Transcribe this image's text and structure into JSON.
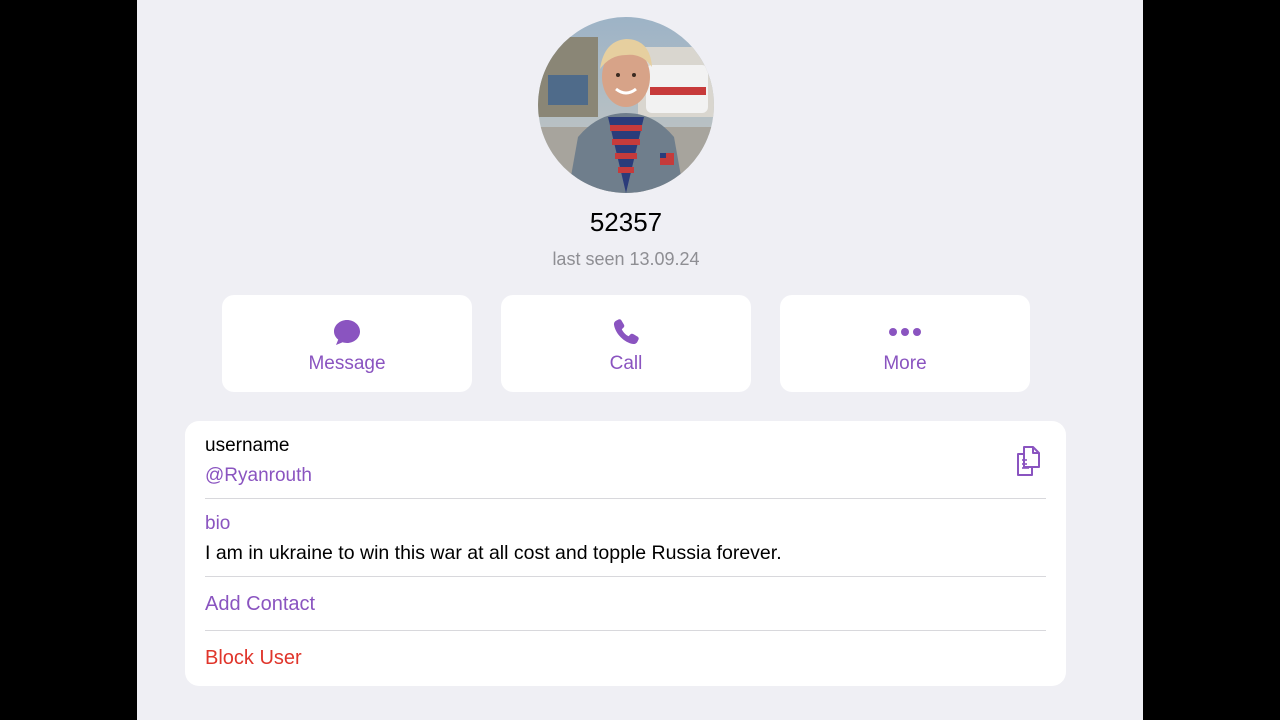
{
  "profile": {
    "display_name": "52357",
    "status": "last seen 13.09.24"
  },
  "actions": {
    "message_label": "Message",
    "call_label": "Call",
    "more_label": "More"
  },
  "info": {
    "username_label": "username",
    "username_value": "@Ryanrouth",
    "bio_label": "bio",
    "bio_value": "I am in ukraine to win this war at all cost and topple Russia forever.",
    "add_contact_label": "Add Contact",
    "block_user_label": "Block User"
  },
  "colors": {
    "accent": "#8a54c0",
    "destructive": "#e0352b",
    "background": "#efeff4",
    "card": "#ffffff",
    "secondary_text": "#8e8e93"
  },
  "icons": {
    "message": "chat-bubble-icon",
    "call": "phone-icon",
    "more": "ellipsis-icon",
    "copy": "copy-icon"
  }
}
